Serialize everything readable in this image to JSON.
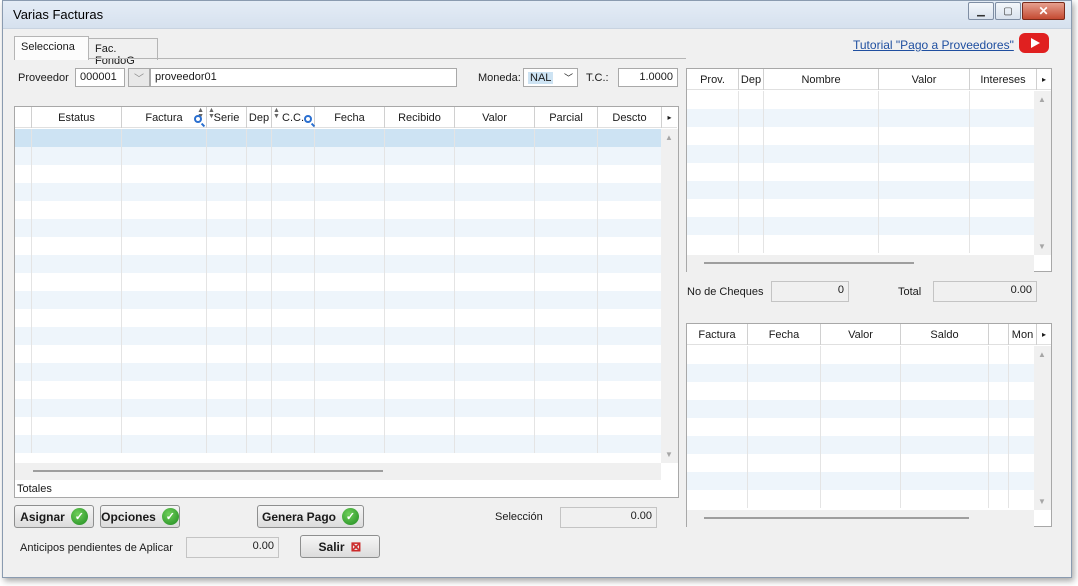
{
  "window": {
    "title": "Varias Facturas"
  },
  "tabs": [
    {
      "label": "Selecciona"
    },
    {
      "label": "Fac. FondoG"
    }
  ],
  "tutorial_link": "Tutorial \"Pago a Proveedores\"",
  "proveedor": {
    "label": "Proveedor",
    "code": "000001",
    "name": "proveedor01"
  },
  "moneda": {
    "label": "Moneda:",
    "value": "NAL"
  },
  "tc": {
    "label": "T.C.:",
    "value": "1.0000"
  },
  "main_grid": {
    "columns": [
      "",
      "Estatus",
      "Factura",
      "Serie",
      "Dep",
      "C.C.",
      "Fecha",
      "Recibido",
      "Valor",
      "Parcial",
      "Descto"
    ],
    "totals_label": "Totales"
  },
  "checks_grid": {
    "columns": [
      "Prov.",
      "Dep",
      "Nombre",
      "Valor",
      "Intereses"
    ]
  },
  "cheques": {
    "label": "No de Cheques",
    "value": "0"
  },
  "total": {
    "label": "Total",
    "value": "0.00"
  },
  "invoice_grid": {
    "columns": [
      "Factura",
      "Fecha",
      "Valor",
      "Saldo",
      "",
      "Mon"
    ]
  },
  "buttons": {
    "asignar": "Asignar",
    "opciones": "Opciones",
    "genera_pago": "Genera Pago",
    "salir": "Salir"
  },
  "seleccion": {
    "label": "Selección",
    "value": "0.00"
  },
  "anticipos": {
    "label": "Anticipos pendientes de Aplicar",
    "value": "0.00"
  },
  "icons": {
    "youtube": "youtube-icon",
    "check": "check-icon",
    "close": "close-icon",
    "search": "search-icon"
  },
  "colors": {
    "row_alt": "#eef5fb",
    "row_selected": "#cde3f3",
    "link": "#1f4fa0",
    "youtube": "#e02020"
  }
}
